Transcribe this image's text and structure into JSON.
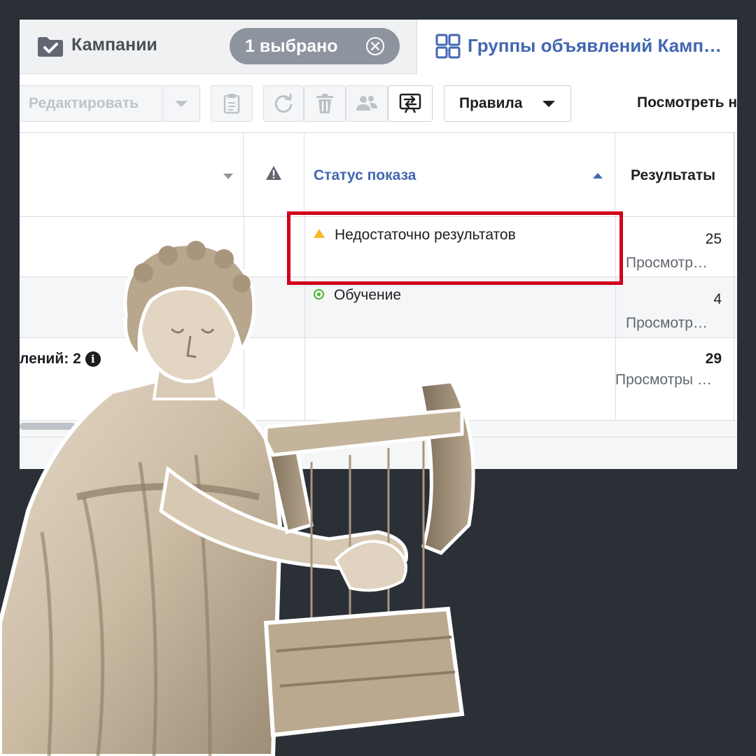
{
  "tabs": {
    "campaigns_label": "Кампании",
    "selection_pill": "1 выбрано",
    "adsets_label": "Группы объявлений Камп…"
  },
  "toolbar": {
    "edit_label": "Редактировать",
    "rules_label": "Правила",
    "view_label": "Посмотреть н"
  },
  "table": {
    "columns": {
      "status": "Статус показа",
      "results": "Результаты"
    },
    "rows": [
      {
        "status": "Недостаточно результатов",
        "status_kind": "warning",
        "results": "25",
        "results_sub": "Просмотр…"
      },
      {
        "status": "Обучение",
        "status_kind": "learning",
        "results": "4",
        "results_sub": "Просмотр…"
      }
    ],
    "summary": {
      "label": "лений: 2",
      "results": "29",
      "results_sub": "Просмотры …"
    }
  },
  "icons": {
    "campaign_folder": "folder-check-icon",
    "pill_close": "close-circle-icon",
    "adsets": "grid-icon",
    "clipboard": "clipboard-icon",
    "refresh": "refresh-icon",
    "delete": "trash-icon",
    "people": "people-icon",
    "compare": "compare-icon",
    "warning": "warning-icon",
    "info": "info-icon"
  },
  "colors": {
    "background": "#2b3037",
    "link_blue": "#4267b2",
    "highlight_red": "#d0021b",
    "warning_yellow": "#f7b928",
    "learning_green": "#42b72a"
  }
}
